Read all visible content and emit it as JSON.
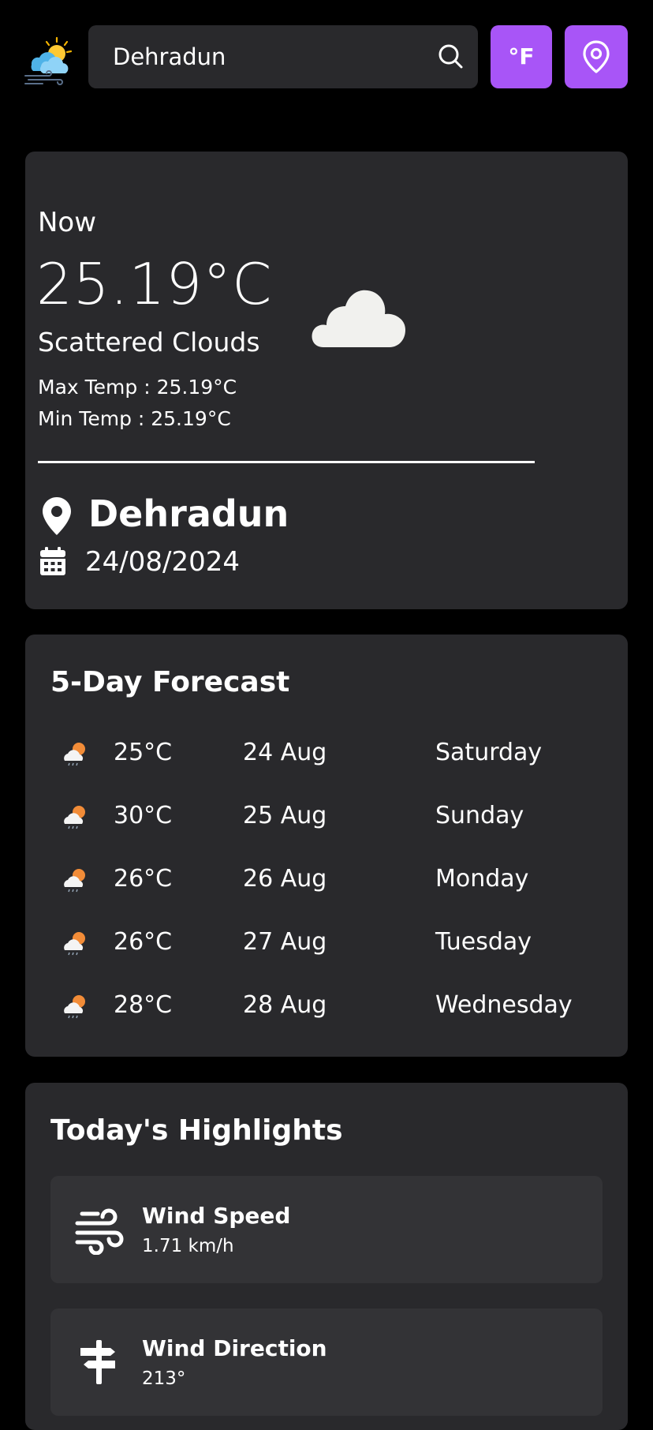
{
  "header": {
    "search": {
      "value": "Dehradun"
    },
    "unit_toggle_label": "°F"
  },
  "current": {
    "now_label": "Now",
    "temperature": "25.19°C",
    "condition": "Scattered Clouds",
    "max_temp": "Max Temp : 25.19°C",
    "min_temp": "Min Temp : 25.19°C",
    "city": "Dehradun",
    "date": "24/08/2024",
    "icon": "cloud-icon"
  },
  "forecast": {
    "title": "5-Day Forecast",
    "days": [
      {
        "temp": "25°C",
        "date": "24 Aug",
        "day": "Saturday",
        "icon": "rain-sun-cloud-icon"
      },
      {
        "temp": "30°C",
        "date": "25 Aug",
        "day": "Sunday",
        "icon": "rain-sun-cloud-icon"
      },
      {
        "temp": "26°C",
        "date": "26 Aug",
        "day": "Monday",
        "icon": "rain-sun-cloud-icon"
      },
      {
        "temp": "26°C",
        "date": "27 Aug",
        "day": "Tuesday",
        "icon": "rain-sun-cloud-icon"
      },
      {
        "temp": "28°C",
        "date": "28 Aug",
        "day": "Wednesday",
        "icon": "rain-sun-cloud-icon"
      }
    ]
  },
  "highlights": {
    "title": "Today's Highlights",
    "items": [
      {
        "label": "Wind Speed",
        "value": "1.71 km/h",
        "icon": "wind-icon"
      },
      {
        "label": "Wind Direction",
        "value": "213°",
        "icon": "signpost-icon"
      }
    ]
  },
  "colors": {
    "accent": "#a855f7",
    "card_bg": "#29292c",
    "page_bg": "#000000"
  }
}
